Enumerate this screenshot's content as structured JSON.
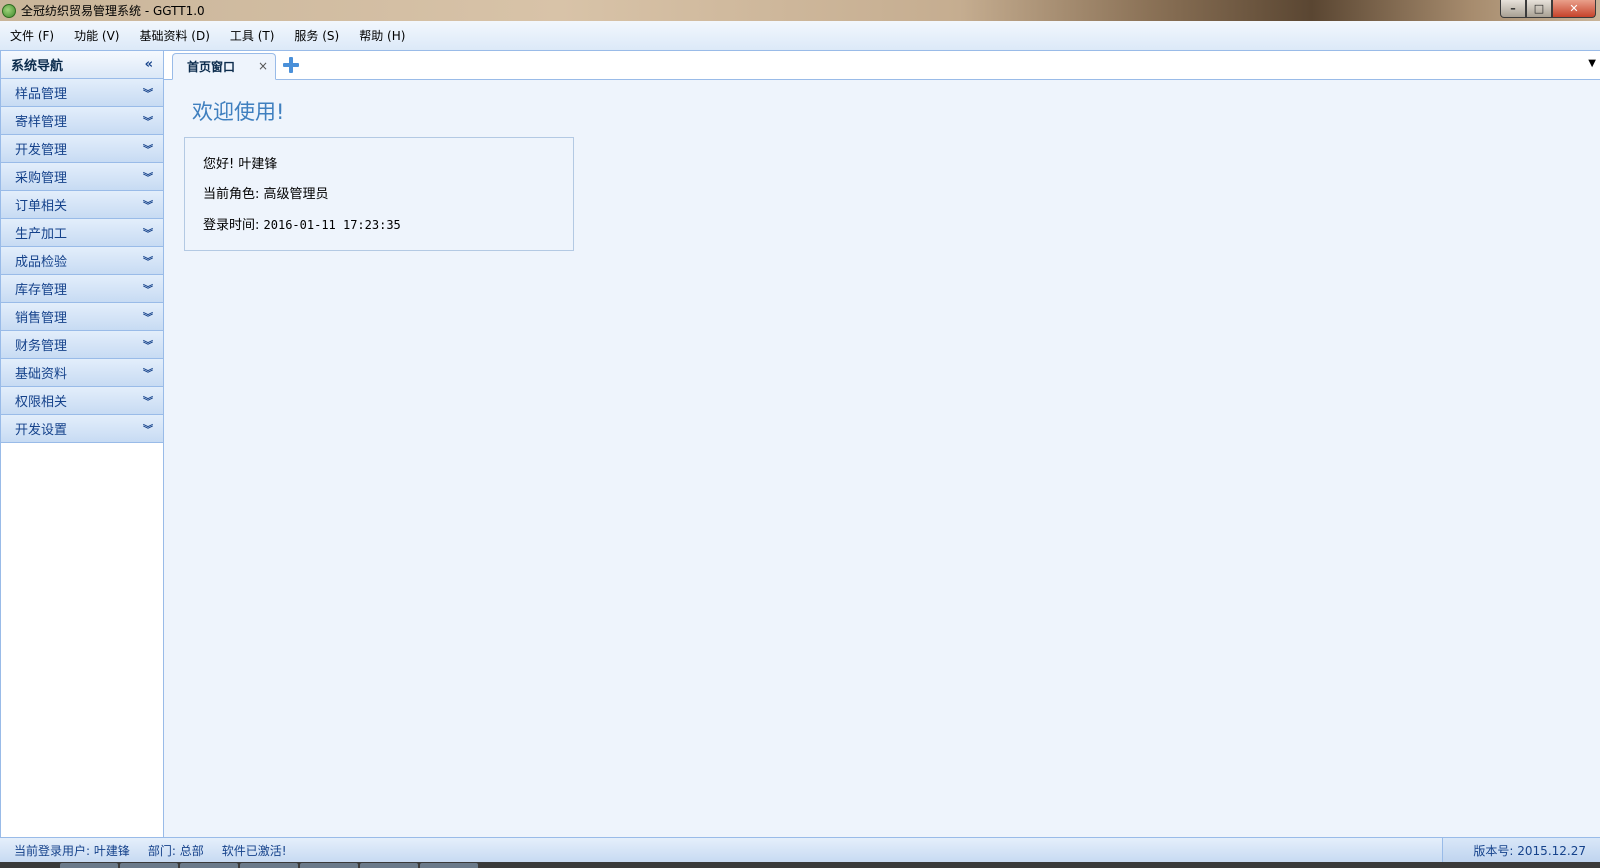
{
  "window": {
    "title": "全冠纺织贸易管理系统 - GGTT1.0",
    "controls": {
      "minimize": "–",
      "maximize": "□",
      "close": "✕"
    }
  },
  "menu": [
    {
      "label": "文件 (F)"
    },
    {
      "label": "功能 (V)"
    },
    {
      "label": "基础资料 (D)"
    },
    {
      "label": "工具 (T)"
    },
    {
      "label": "服务 (S)"
    },
    {
      "label": "帮助 (H)"
    }
  ],
  "sidebar": {
    "title": "系统导航",
    "collapse_glyph": "«",
    "items": [
      {
        "label": "样品管理"
      },
      {
        "label": "寄样管理"
      },
      {
        "label": "开发管理"
      },
      {
        "label": "采购管理"
      },
      {
        "label": "订单相关"
      },
      {
        "label": "生产加工"
      },
      {
        "label": "成品检验"
      },
      {
        "label": "库存管理"
      },
      {
        "label": "销售管理"
      },
      {
        "label": "财务管理"
      },
      {
        "label": "基础资料"
      },
      {
        "label": "权限相关"
      },
      {
        "label": "开发设置"
      }
    ],
    "chevron_glyph": "︾"
  },
  "tabs": {
    "active": {
      "label": "首页窗口",
      "close_glyph": "×"
    }
  },
  "home": {
    "welcome": "欢迎使用!",
    "greeting": "您好! 叶建锋",
    "role_label": "当前角色: ",
    "role_value": "高级管理员",
    "login_label": "登录时间: ",
    "login_value": "2016-01-11 17:23:35"
  },
  "status": {
    "user": "当前登录用户: 叶建锋",
    "dept": "部门: 总部",
    "activation": "软件已激活!",
    "version": "版本号: 2015.12.27"
  },
  "colors": {
    "accent": "#15428b",
    "border": "#99bbe8",
    "content_bg": "#eef4fc",
    "welcome": "#3f7fbf"
  }
}
